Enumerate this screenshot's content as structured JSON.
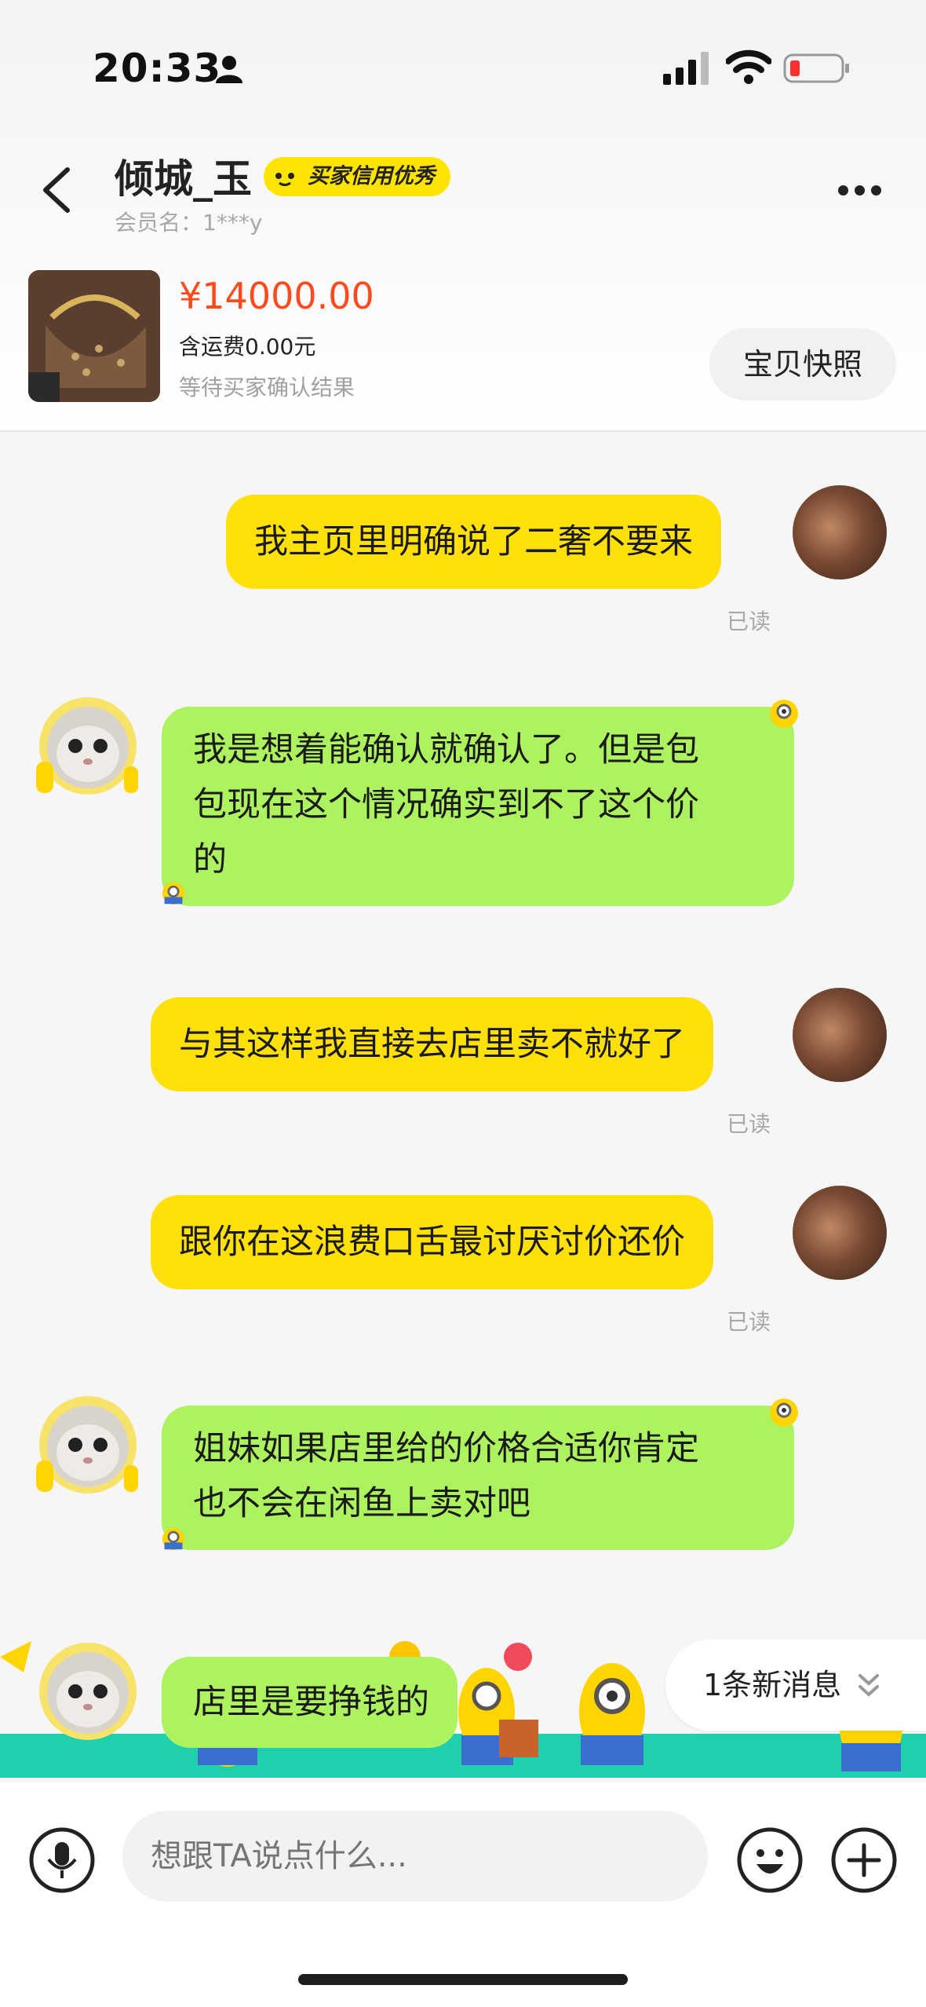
{
  "status_bar": {
    "time": "20:33"
  },
  "header": {
    "username": "倾城_玉",
    "badge": "买家信用优秀",
    "member_label": "会员名：1***y"
  },
  "product": {
    "price": "¥14000.00",
    "shipping": "含运费0.00元",
    "status": "等待买家确认结果",
    "snapshot_button": "宝贝快照"
  },
  "messages": [
    {
      "from": "me",
      "text": "我主页里明确说了二奢不要来",
      "read": "已读"
    },
    {
      "from": "them",
      "lines": [
        "我是想着能确认就确认了。但是包",
        "包现在这个情况确实到不了这个价",
        "的"
      ]
    },
    {
      "from": "me",
      "text": "与其这样我直接去店里卖不就好了",
      "read": "已读"
    },
    {
      "from": "me",
      "text": "跟你在这浪费口舌最讨厌讨价还价",
      "read": "已读"
    },
    {
      "from": "them",
      "lines": [
        "姐妹如果店里给的价格合适你肯定",
        "也不会在闲鱼上卖对吧"
      ]
    },
    {
      "from": "them",
      "text": "店里是要挣钱的"
    }
  ],
  "new_message_pill": "1条新消息",
  "composer": {
    "placeholder": "想跟TA说点什么..."
  },
  "colors": {
    "my_bubble": "#ffe00a",
    "their_bubble": "#adf25f",
    "price": "#ff4a1e",
    "badge": "#ffe400"
  }
}
